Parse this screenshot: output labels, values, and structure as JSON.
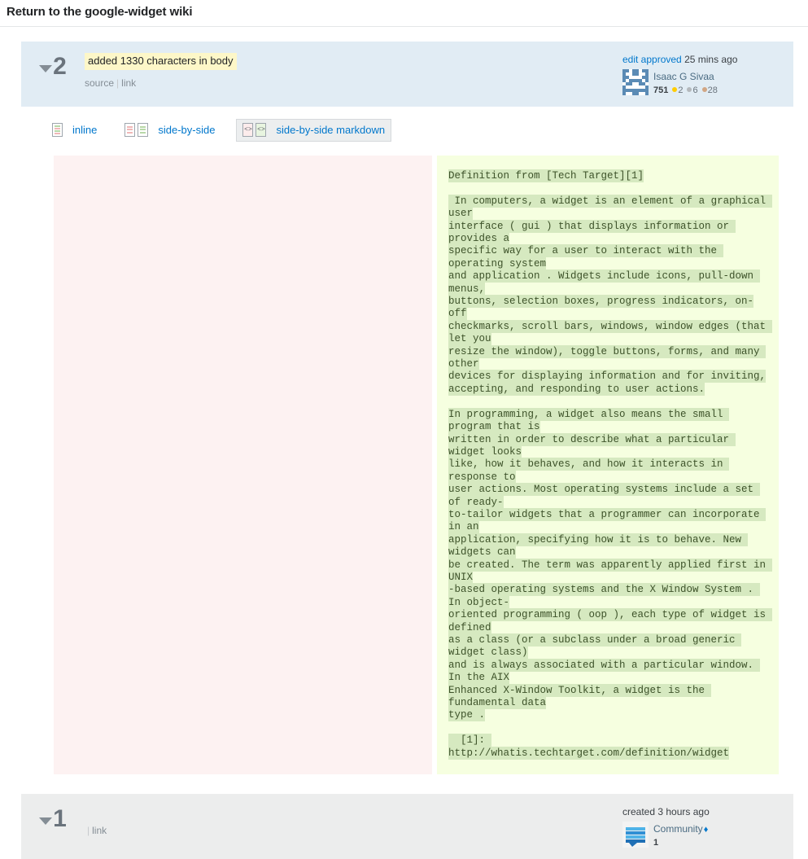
{
  "page": {
    "title": "Return to the google-widget wiki"
  },
  "revisions": [
    {
      "number": "2",
      "comment": "added 1330 characters in body",
      "links": {
        "source": "source",
        "link": "link",
        "separator": "|"
      },
      "time_action": "edit approved",
      "time_text": "25 mins ago",
      "user": {
        "name": "Isaac G Sivaa",
        "avatar_icon": "identicon-avatar",
        "reputation": "751",
        "badges": {
          "gold": "2",
          "silver": "6",
          "bronze": "28"
        },
        "moderator": false
      },
      "theme": "blue"
    },
    {
      "number": "1",
      "comment": "",
      "links": {
        "source": "",
        "link": "link",
        "separator": "|"
      },
      "time_action": "created",
      "time_text": "3 hours ago",
      "user": {
        "name": "Community",
        "avatar_icon": "community-bubble-avatar",
        "reputation": "1",
        "badges": {
          "gold": "",
          "silver": "",
          "bronze": ""
        },
        "moderator": true,
        "diamond": "♦"
      },
      "theme": "grey"
    }
  ],
  "tabs": [
    {
      "label": "inline",
      "icon": "inline-diff-icon",
      "selected": false
    },
    {
      "label": "side-by-side",
      "icon": "side-by-side-diff-icon",
      "selected": false
    },
    {
      "label": "side-by-side markdown",
      "icon": "side-by-side-markdown-icon",
      "selected": true
    }
  ],
  "diff": {
    "left": {
      "content": ""
    },
    "right": {
      "lines": [
        [
          {
            "t": "Definition from [Tech Target][1]",
            "ins": true
          }
        ],
        [],
        [
          {
            "t": " In computers, a widget is an element of a graphical user",
            "ins": true
          }
        ],
        [
          {
            "t": "interface ( gui ) that displays information or provides a",
            "ins": true
          }
        ],
        [
          {
            "t": "specific way for a user to interact with the operating system",
            "ins": true
          }
        ],
        [
          {
            "t": "and application . Widgets include icons, pull-down menus,",
            "ins": true
          }
        ],
        [
          {
            "t": "buttons, selection boxes, progress indicators, on-off",
            "ins": true
          }
        ],
        [
          {
            "t": "checkmarks, scroll bars, windows, window edges (that let you",
            "ins": true
          }
        ],
        [
          {
            "t": "resize the window), toggle buttons, forms, and many other",
            "ins": true
          }
        ],
        [
          {
            "t": "devices for displaying information and for inviting,",
            "ins": true
          }
        ],
        [
          {
            "t": "accepting, and responding to user actions.",
            "ins": true
          }
        ],
        [],
        [
          {
            "t": "In programming, a widget also means the small program that is",
            "ins": true
          }
        ],
        [
          {
            "t": "written in order to describe what a particular widget looks",
            "ins": true
          }
        ],
        [
          {
            "t": "like, how it behaves, and how it interacts in response to",
            "ins": true
          }
        ],
        [
          {
            "t": "user actions. Most operating systems include a set of ready-",
            "ins": true
          }
        ],
        [
          {
            "t": "to-tailor widgets that a programmer can incorporate in an",
            "ins": true
          }
        ],
        [
          {
            "t": "application, specifying how it is to behave. New widgets can",
            "ins": true
          }
        ],
        [
          {
            "t": "be created. The term was apparently applied first in UNIX",
            "ins": true
          }
        ],
        [
          {
            "t": "-based operating systems and the X Window System . In object-",
            "ins": true
          }
        ],
        [
          {
            "t": "oriented programming ( oop ), each type of widget is defined",
            "ins": true
          }
        ],
        [
          {
            "t": "as a class (or a subclass under a broad generic widget class)",
            "ins": true
          }
        ],
        [
          {
            "t": "and is always associated with a particular window. In the AIX",
            "ins": true
          }
        ],
        [
          {
            "t": "Enhanced X-Window Toolkit, a widget is the fundamental data",
            "ins": true
          }
        ],
        [
          {
            "t": "type .",
            "ins": true
          }
        ],
        [],
        [
          {
            "t": "  [1]: http://whatis.techtarget.com/definition/widget",
            "ins": true
          }
        ]
      ]
    }
  },
  "colors": {
    "link": "#0077cc",
    "insert_bg": "#d6e9c0",
    "insert_pane_bg": "#f6ffe0",
    "delete_pane_bg": "#fdf2f2",
    "comment_highlight": "#fdf7c8",
    "rev_blue": "#e1ecf4",
    "rev_grey": "#eceded",
    "gold": "#ffcc01",
    "silver": "#b4b8bc",
    "bronze": "#d1a684"
  }
}
